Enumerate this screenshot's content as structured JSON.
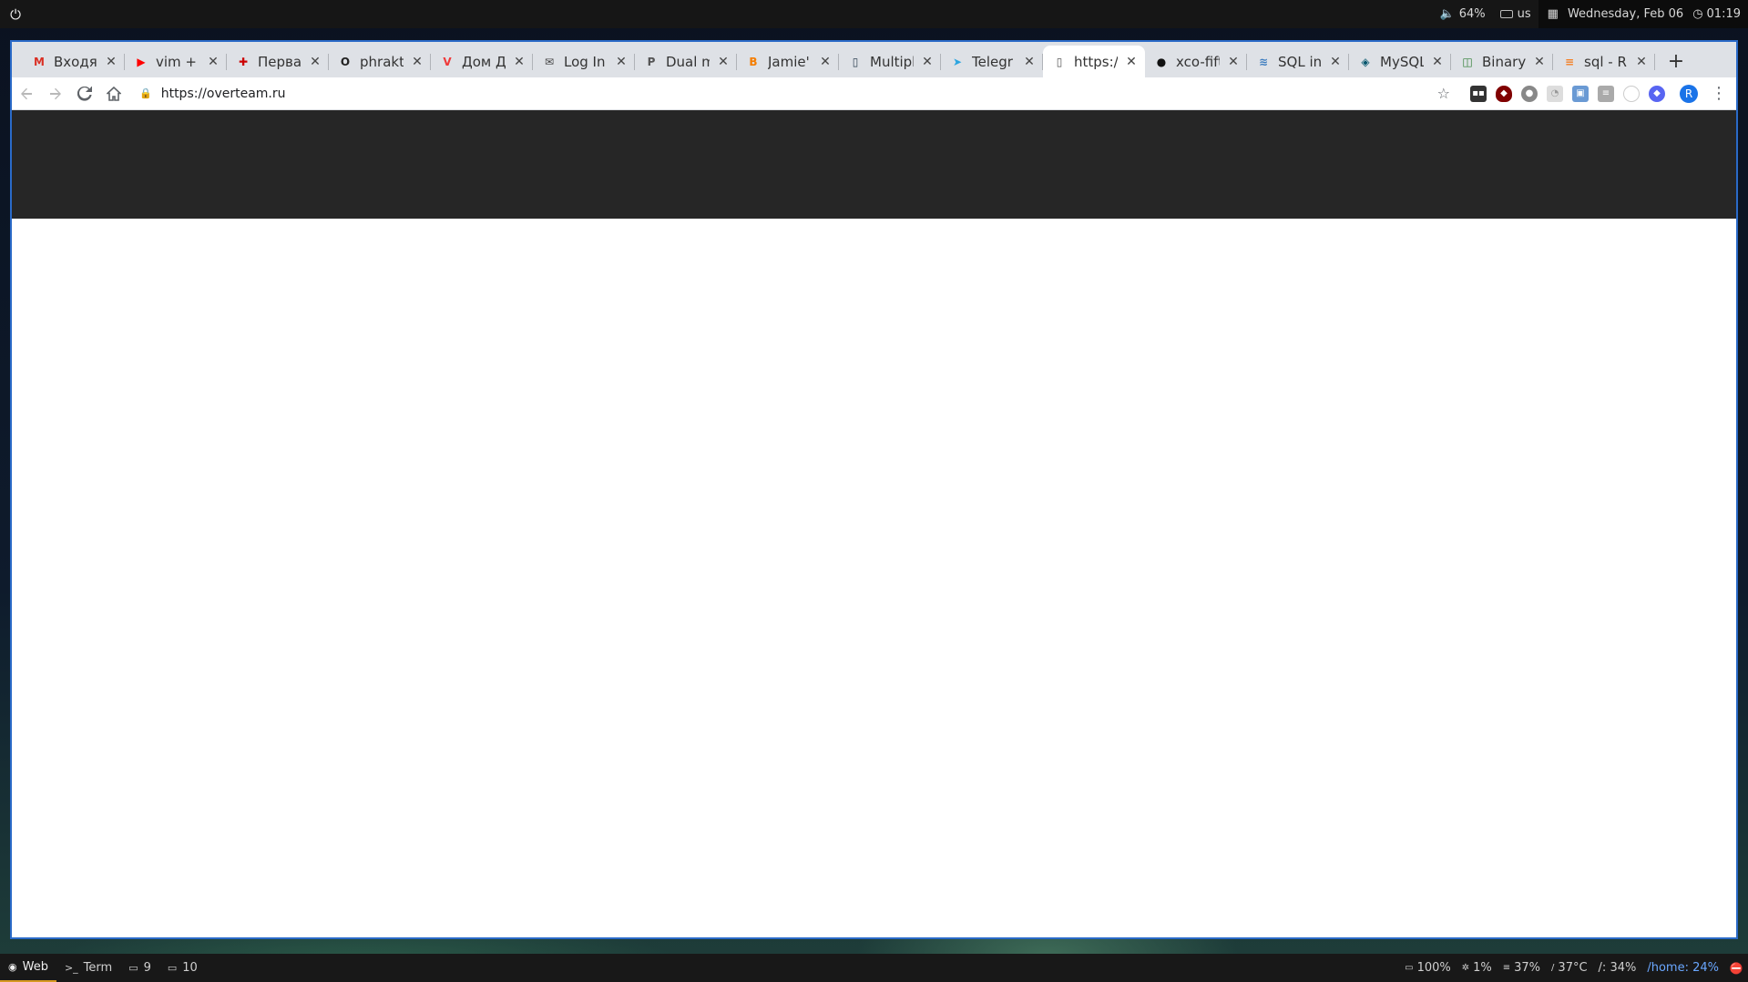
{
  "topbar": {
    "volume": "64%",
    "keyboard_layout": "us",
    "date": "Wednesday, Feb 06",
    "time": "01:19"
  },
  "browser": {
    "tabs": [
      {
        "title": "Входящ",
        "favicon": "gmail-icon",
        "color": "#d93025"
      },
      {
        "title": "vim + t",
        "favicon": "youtube-icon",
        "color": "#ff0000"
      },
      {
        "title": "Перва",
        "favicon": "red-cross-icon",
        "color": "#cc0000"
      },
      {
        "title": "phrakt",
        "favicon": "ring-icon",
        "color": "#222222"
      },
      {
        "title": "Дом Д",
        "favicon": "vivaldi-icon",
        "color": "#ef3939"
      },
      {
        "title": "Log In",
        "favicon": "mail-icon",
        "color": "#444444"
      },
      {
        "title": "Dual m",
        "favicon": "p-icon",
        "color": "#555555"
      },
      {
        "title": "Jamie'",
        "favicon": "blogger-icon",
        "color": "#f57d00"
      },
      {
        "title": "Multipl",
        "favicon": "doc-icon",
        "color": "#2c3e50"
      },
      {
        "title": "Telegr",
        "favicon": "telegram-icon",
        "color": "#2ca5e0"
      },
      {
        "title": "https://",
        "favicon": "page-icon",
        "color": "#555555",
        "active": true
      },
      {
        "title": "xco-fift",
        "favicon": "github-icon",
        "color": "#111111"
      },
      {
        "title": "SQL in",
        "favicon": "stack-icon",
        "color": "#3d7dbf"
      },
      {
        "title": "MySQL",
        "favicon": "mysql-icon",
        "color": "#00546b"
      },
      {
        "title": "Binary",
        "favicon": "binary-icon",
        "color": "#2e7d32"
      },
      {
        "title": "sql - R",
        "favicon": "stackoverflow-icon",
        "color": "#f48024"
      }
    ],
    "new_tab_label": "+",
    "url": "https://overteam.ru",
    "profile_initial": "R"
  },
  "bottombar": {
    "workspaces": [
      {
        "label": "Web",
        "icon": "chrome-icon",
        "active": true
      },
      {
        "label": "Term",
        "icon": "terminal-icon"
      },
      {
        "label": "9",
        "icon": "monitor-icon"
      },
      {
        "label": "10",
        "icon": "monitor-icon"
      }
    ],
    "stats": {
      "brightness": "100%",
      "cpu": "1%",
      "memory": "37%",
      "temperature": "37°C",
      "root_disk": "/: 34%",
      "home_disk": "/home: 24%"
    }
  }
}
